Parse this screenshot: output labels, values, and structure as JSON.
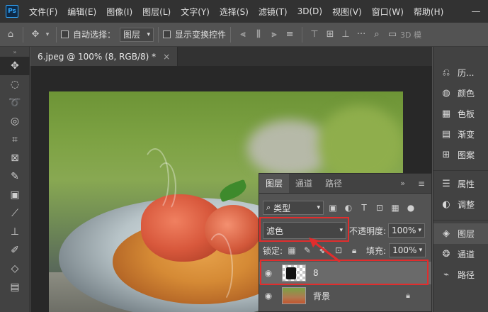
{
  "app": {
    "logo": "Ps"
  },
  "menu": [
    "文件(F)",
    "编辑(E)",
    "图像(I)",
    "图层(L)",
    "文字(Y)",
    "选择(S)",
    "滤镜(T)",
    "3D(D)",
    "视图(V)",
    "窗口(W)",
    "帮助(H)"
  ],
  "options_bar": {
    "auto_select_label": "自动选择：",
    "auto_select_value": "图层",
    "show_transform_label": "显示变换控件",
    "mode_3d_label": "3D 模"
  },
  "document": {
    "tab_title": "6.jpeg @ 100% (8, RGB/8) *"
  },
  "layers_panel": {
    "tabs": [
      "图层",
      "通道",
      "路径"
    ],
    "filter_kind": "类型",
    "blend_mode": "滤色",
    "opacity_label": "不透明度:",
    "opacity_value": "100%",
    "lock_label": "锁定:",
    "fill_label": "填充:",
    "fill_value": "100%",
    "layers": [
      {
        "name": "8",
        "selected": true
      },
      {
        "name": "背景",
        "locked": true
      }
    ]
  },
  "dock": {
    "group1": [
      "历...",
      "颜色",
      "色板",
      "渐变",
      "图案"
    ],
    "group2": [
      "属性",
      "调整"
    ],
    "group3": [
      "图层",
      "通道",
      "路径"
    ]
  },
  "colors": {
    "highlight": "#e12d2d",
    "selected_layer": "#6a6a6a"
  }
}
